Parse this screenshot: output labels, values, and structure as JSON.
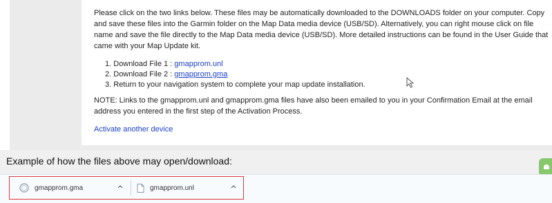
{
  "instructions": {
    "main_paragraph": "Please click on the two links below. These files may be automatically downloaded to the DOWNLOADS folder on your computer. Copy and save these files into the Garmin folder on the Map Data media device (USB/SD). Alternatively, you can right mouse click on file name and save the file directly to the Map Data media device (USB/SD). More detailed instructions can be found in the User Guide that came with your Map Update kit.",
    "steps": [
      {
        "number": "1.",
        "text": "Download File 1 : ",
        "link": "gmapprom.unl"
      },
      {
        "number": "2.",
        "text": "Download File 2 : ",
        "link": "gmapprom.gma"
      },
      {
        "number": "3.",
        "text": "Return to your navigation system to complete your map update installation.",
        "link": ""
      }
    ],
    "note": "NOTE: Links to the gmapprom.unl and gmapprom.gma files have also been emailed to you in your Confirmation Email at the email address you entered in the first step of the Activation Process.",
    "activate_link": "Activate another device"
  },
  "example_heading": "Example of how the files above may open/download:",
  "downloads": [
    {
      "name": "gmapprom.gma",
      "icon": "spinner-circle-icon"
    },
    {
      "name": "gmapprom.unl",
      "icon": "file-icon"
    }
  ],
  "colors": {
    "link": "#1a3fc4",
    "highlight_border": "#e03a3a",
    "side_chip": "#86c86a",
    "download_bar": "#f8fbfe"
  }
}
